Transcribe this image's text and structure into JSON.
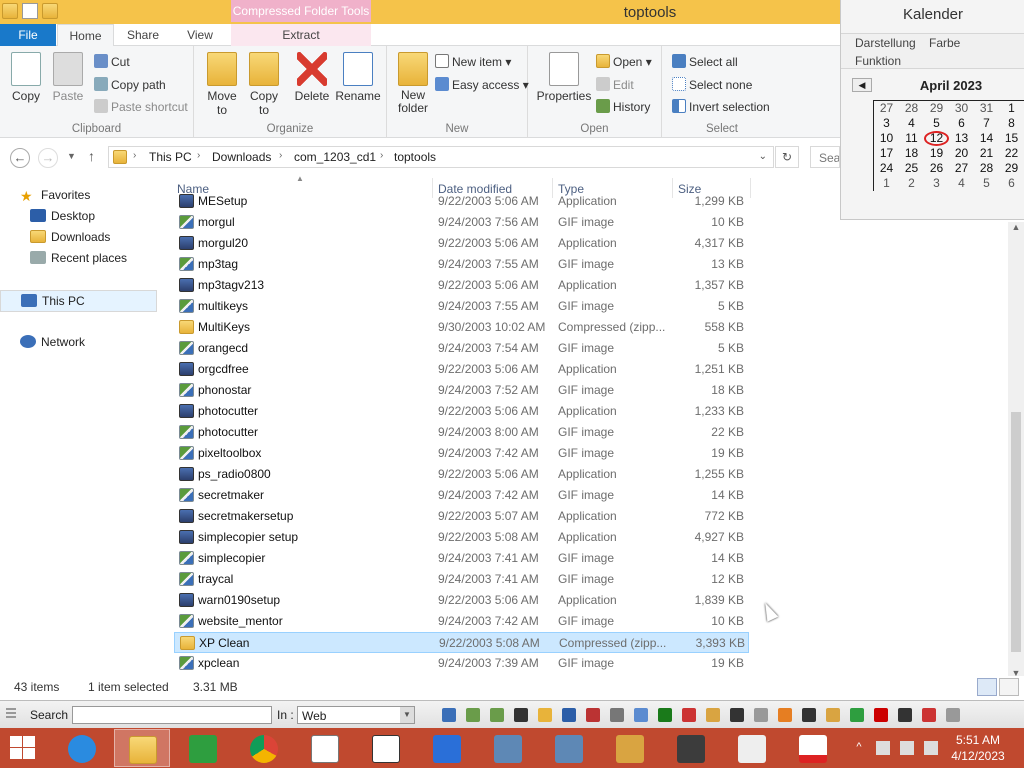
{
  "window": {
    "title": "toptools",
    "context_tab": "Compressed Folder Tools"
  },
  "tabs": [
    {
      "label": "File"
    },
    {
      "label": "Home"
    },
    {
      "label": "Share"
    },
    {
      "label": "View"
    },
    {
      "label": "Extract"
    }
  ],
  "ribbon": {
    "clipboard": {
      "label": "Clipboard",
      "copy": "Copy",
      "paste": "Paste",
      "cut": "Cut",
      "copy_path": "Copy path",
      "paste_shortcut": "Paste shortcut"
    },
    "organize": {
      "label": "Organize",
      "move_to": "Move to",
      "copy_to": "Copy to",
      "delete": "Delete",
      "rename": "Rename"
    },
    "new": {
      "label": "New",
      "new_folder": "New folder",
      "new_item": "New item",
      "easy_access": "Easy access"
    },
    "open": {
      "label": "Open",
      "properties": "Properties",
      "open": "Open",
      "edit": "Edit",
      "history": "History"
    },
    "select": {
      "label": "Select",
      "select_all": "Select all",
      "select_none": "Select none",
      "invert_selection": "Invert selection"
    }
  },
  "calendar": {
    "title": "Kalender",
    "menu": [
      "Darstellung",
      "Farbe",
      "Funktion"
    ],
    "month": "April 2023",
    "weeks": [
      [
        "27",
        "28",
        "29",
        "30",
        "31",
        "1"
      ],
      [
        "3",
        "4",
        "5",
        "6",
        "7",
        "8"
      ],
      [
        "10",
        "11",
        "12",
        "13",
        "14",
        "15"
      ],
      [
        "17",
        "18",
        "19",
        "20",
        "21",
        "22"
      ],
      [
        "24",
        "25",
        "26",
        "27",
        "28",
        "29"
      ],
      [
        "1",
        "2",
        "3",
        "4",
        "5",
        "6"
      ]
    ]
  },
  "address": {
    "crumbs": [
      "This PC",
      "Downloads",
      "com_1203_cd1",
      "toptools"
    ],
    "search_placeholder": "Sear"
  },
  "navpane": {
    "favorites": "Favorites",
    "desktop": "Desktop",
    "downloads": "Downloads",
    "recent": "Recent places",
    "this_pc": "This PC",
    "network": "Network"
  },
  "columns": {
    "name": "Name",
    "date": "Date modified",
    "type": "Type",
    "size": "Size"
  },
  "files": [
    {
      "name": "MESetup",
      "date": "9/22/2003 5:06 AM",
      "type": "Application",
      "size": "1,299 KB",
      "icon": "app"
    },
    {
      "name": "morgul",
      "date": "9/24/2003 7:56 AM",
      "type": "GIF image",
      "size": "10 KB",
      "icon": "gif"
    },
    {
      "name": "morgul20",
      "date": "9/22/2003 5:06 AM",
      "type": "Application",
      "size": "4,317 KB",
      "icon": "app"
    },
    {
      "name": "mp3tag",
      "date": "9/24/2003 7:55 AM",
      "type": "GIF image",
      "size": "13 KB",
      "icon": "gif"
    },
    {
      "name": "mp3tagv213",
      "date": "9/22/2003 5:06 AM",
      "type": "Application",
      "size": "1,357 KB",
      "icon": "app"
    },
    {
      "name": "multikeys",
      "date": "9/24/2003 7:55 AM",
      "type": "GIF image",
      "size": "5 KB",
      "icon": "gif"
    },
    {
      "name": "MultiKeys",
      "date": "9/30/2003 10:02 AM",
      "type": "Compressed (zipp...",
      "size": "558 KB",
      "icon": "zip"
    },
    {
      "name": "orangecd",
      "date": "9/24/2003 7:54 AM",
      "type": "GIF image",
      "size": "5 KB",
      "icon": "gif"
    },
    {
      "name": "orgcdfree",
      "date": "9/22/2003 5:06 AM",
      "type": "Application",
      "size": "1,251 KB",
      "icon": "app"
    },
    {
      "name": "phonostar",
      "date": "9/24/2003 7:52 AM",
      "type": "GIF image",
      "size": "18 KB",
      "icon": "gif"
    },
    {
      "name": "photocutter",
      "date": "9/22/2003 5:06 AM",
      "type": "Application",
      "size": "1,233 KB",
      "icon": "app"
    },
    {
      "name": "photocutter",
      "date": "9/24/2003 8:00 AM",
      "type": "GIF image",
      "size": "22 KB",
      "icon": "gif"
    },
    {
      "name": "pixeltoolbox",
      "date": "9/24/2003 7:42 AM",
      "type": "GIF image",
      "size": "19 KB",
      "icon": "gif"
    },
    {
      "name": "ps_radio0800",
      "date": "9/22/2003 5:06 AM",
      "type": "Application",
      "size": "1,255 KB",
      "icon": "app"
    },
    {
      "name": "secretmaker",
      "date": "9/24/2003 7:42 AM",
      "type": "GIF image",
      "size": "14 KB",
      "icon": "gif"
    },
    {
      "name": "secretmakersetup",
      "date": "9/22/2003 5:07 AM",
      "type": "Application",
      "size": "772 KB",
      "icon": "app"
    },
    {
      "name": "simplecopier setup",
      "date": "9/22/2003 5:08 AM",
      "type": "Application",
      "size": "4,927 KB",
      "icon": "app"
    },
    {
      "name": "simplecopier",
      "date": "9/24/2003 7:41 AM",
      "type": "GIF image",
      "size": "14 KB",
      "icon": "gif"
    },
    {
      "name": "traycal",
      "date": "9/24/2003 7:41 AM",
      "type": "GIF image",
      "size": "12 KB",
      "icon": "gif"
    },
    {
      "name": "warn0190setup",
      "date": "9/22/2003 5:06 AM",
      "type": "Application",
      "size": "1,839 KB",
      "icon": "app"
    },
    {
      "name": "website_mentor",
      "date": "9/24/2003 7:42 AM",
      "type": "GIF image",
      "size": "10 KB",
      "icon": "gif"
    },
    {
      "name": "XP Clean",
      "date": "9/22/2003 5:08 AM",
      "type": "Compressed (zipp...",
      "size": "3,393 KB",
      "icon": "zip",
      "selected": true
    },
    {
      "name": "xpclean",
      "date": "9/24/2003 7:39 AM",
      "type": "GIF image",
      "size": "19 KB",
      "icon": "gif"
    }
  ],
  "status": {
    "items": "43 items",
    "selected": "1 item selected",
    "size": "3.31 MB"
  },
  "searchbar": {
    "search_label": "Search :",
    "in_label": "In :",
    "in_value": "Web"
  },
  "clock": {
    "time": "5:51 AM",
    "date": "4/12/2023"
  },
  "colors": {
    "taskbar": "#c0492f",
    "titlebar": "#f5c34a",
    "selection": "#cce8ff"
  }
}
